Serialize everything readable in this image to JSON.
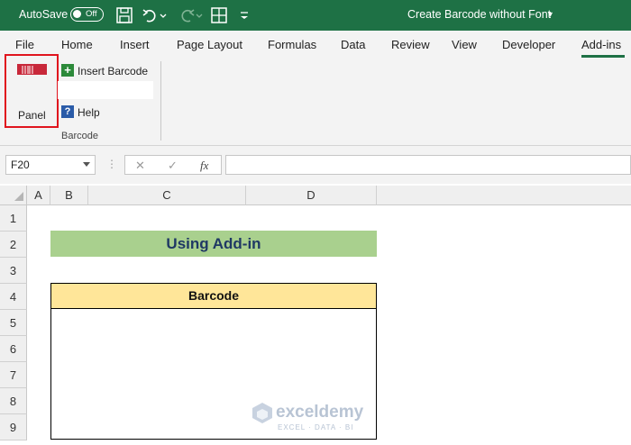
{
  "titlebar": {
    "autosave_label": "AutoSave",
    "autosave_state": "Off",
    "document_title": "Create Barcode without Font",
    "title_caret": "▾"
  },
  "tabs": [
    "File",
    "Home",
    "Insert",
    "Page Layout",
    "Formulas",
    "Data",
    "Review",
    "View",
    "Developer",
    "Add-ins"
  ],
  "active_tab": "Add-ins",
  "ribbon": {
    "panel_label": "Panel",
    "insert_barcode_label": "Insert Barcode",
    "insert_barcode_icon": "+",
    "help_label": "Help",
    "help_icon": "?",
    "group_label": "Barcode"
  },
  "formula_bar": {
    "name_box": "F20",
    "cancel_symbol": "✕",
    "enter_symbol": "✓",
    "fx_symbol": "fx",
    "formula": ""
  },
  "sheet": {
    "columns": [
      "A",
      "B",
      "C",
      "D"
    ],
    "rows": [
      "1",
      "2",
      "3",
      "4",
      "5",
      "6",
      "7",
      "8",
      "9"
    ],
    "title_cell": "Using Add-in",
    "header_cell": "Barcode"
  },
  "watermark": {
    "name": "exceldemy",
    "tagline": "EXCEL · DATA · BI"
  },
  "colors": {
    "excel_green": "#1e7145",
    "title_fill": "#a9d08e",
    "header_fill": "#ffe699",
    "highlight_red": "#e0141e"
  }
}
